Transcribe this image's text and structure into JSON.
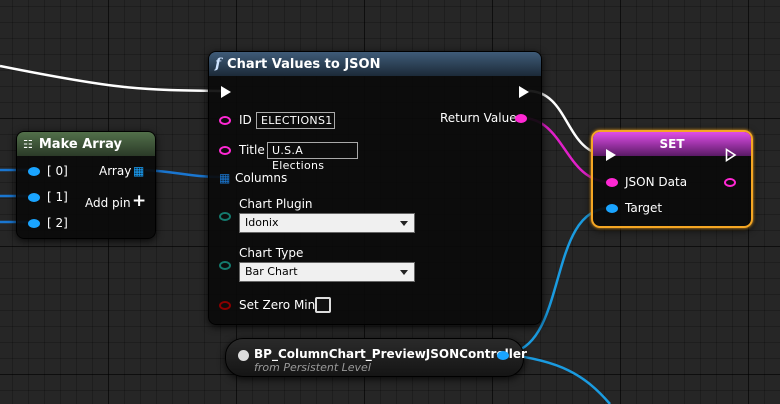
{
  "chart_node": {
    "title_icon": "function-icon",
    "title": "Chart Values to JSON",
    "id_label": "ID",
    "id_value": "ELECTIONS1",
    "title_label": "Title",
    "title_value": "U.S.A Elections",
    "columns_label": "Columns",
    "plugin_label": "Chart Plugin",
    "plugin_value": "Idonix",
    "type_label": "Chart Type",
    "type_value": "Bar Chart",
    "zero_min_label": "Set Zero Min",
    "return_label": "Return Value"
  },
  "make_array_node": {
    "title": "Make Array",
    "pins": [
      "[ 0]",
      "[ 1]",
      "[ 2]"
    ],
    "array_label": "Array",
    "add_pin_label": "Add pin"
  },
  "set_node": {
    "title": "SET",
    "json_label": "JSON Data",
    "target_label": "Target"
  },
  "ref_node": {
    "name": "BP_ColumnChart_PreviewJSONController",
    "subtitle": "from Persistent Level"
  },
  "colors": {
    "string_pin": "#ff28d4",
    "object_pin": "#1aa4ff",
    "exec_pin": "#ffffff",
    "struct_pin": "#147a6e",
    "bool_pin": "#8b0000",
    "set_border": "#f5a623",
    "chart_header": "#2a3d52",
    "make_array_header": "#3b5236",
    "set_header": "#c62bd6"
  }
}
